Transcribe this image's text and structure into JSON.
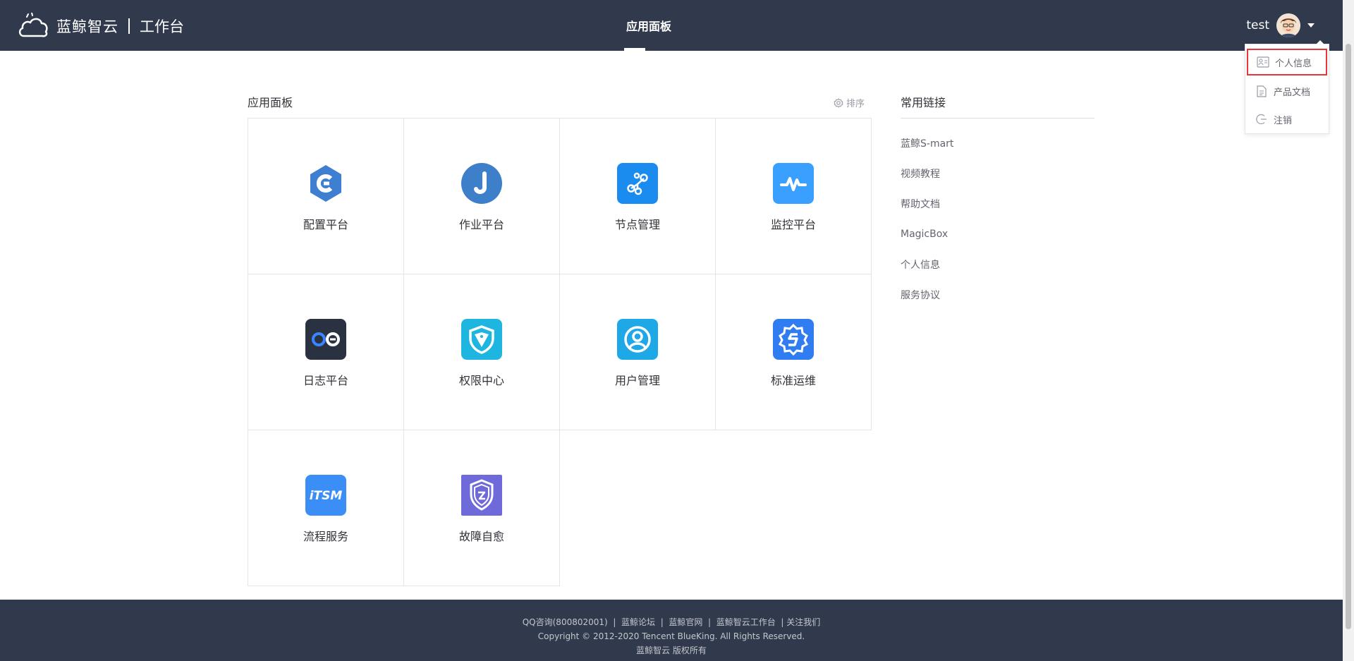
{
  "header": {
    "logo_text": "蓝鲸智云",
    "logo_sub": "工作台",
    "nav_item": "应用面板",
    "user_name": "test"
  },
  "dropdown": {
    "items": [
      {
        "label": "个人信息",
        "icon": "id-card-icon",
        "active": true
      },
      {
        "label": "产品文档",
        "icon": "document-icon",
        "active": false
      },
      {
        "label": "注销",
        "icon": "logout-icon",
        "active": false
      }
    ]
  },
  "main": {
    "title": "应用面板",
    "sort_label": "排序",
    "apps": [
      {
        "name": "配置平台",
        "icon": "cmdb-icon",
        "color": "#3a84ff"
      },
      {
        "name": "作业平台",
        "icon": "job-icon",
        "color": "#3d7fc9"
      },
      {
        "name": "节点管理",
        "icon": "node-icon",
        "color": "#1a8cf0"
      },
      {
        "name": "监控平台",
        "icon": "monitor-icon",
        "color": "#3aa0ff"
      },
      {
        "name": "日志平台",
        "icon": "log-icon",
        "color": "#2a3242"
      },
      {
        "name": "权限中心",
        "icon": "shield-icon",
        "color": "#1eb6e0"
      },
      {
        "name": "用户管理",
        "icon": "user-icon",
        "color": "#1fa8e6"
      },
      {
        "name": "标准运维",
        "icon": "sops-icon",
        "color": "#2f7df0"
      },
      {
        "name": "流程服务",
        "icon": "itsm-icon",
        "color": "#3a8ef6"
      },
      {
        "name": "故障自愈",
        "icon": "fault-heal-icon",
        "color": "#6f6ad9"
      }
    ]
  },
  "links": {
    "title": "常用链接",
    "items": [
      "蓝鲸S-mart",
      "视频教程",
      "帮助文档",
      "MagicBox",
      "个人信息",
      "服务协议"
    ]
  },
  "footer": {
    "links": [
      "QQ咨询(800802001)",
      "蓝鲸论坛",
      "蓝鲸官网",
      "蓝鲸智云工作台",
      "关注我们"
    ],
    "copyright": "Copyright © 2012-2020 Tencent BlueKing. All Rights Reserved.",
    "rights": "蓝鲸智云 版权所有"
  }
}
